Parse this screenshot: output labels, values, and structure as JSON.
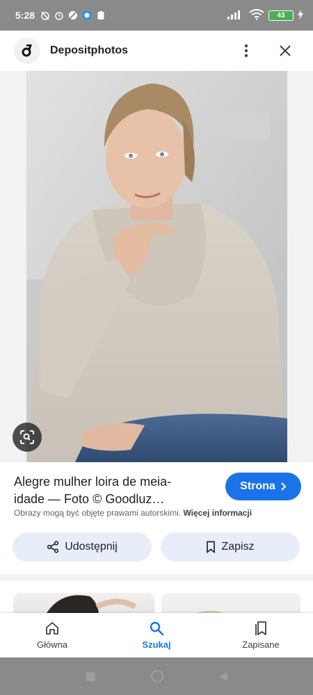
{
  "status_bar": {
    "time": "5:28",
    "battery": "43"
  },
  "header": {
    "site_name": "Depositphotos"
  },
  "result": {
    "title": "Alegre mulher loira de meia-idade — Foto © Goodluz…",
    "visit_label": "Strona",
    "copyright_notice": "Obrazy mogą być objęte prawami autorskimi.",
    "more_info_label": "Więcej informacji",
    "share_label": "Udostępnij",
    "save_label": "Zapisz"
  },
  "bottom_nav": {
    "items": [
      {
        "label": "Główna",
        "icon": "home-icon",
        "active": false
      },
      {
        "label": "Szukaj",
        "icon": "search-icon",
        "active": true
      },
      {
        "label": "Zapisane",
        "icon": "bookmarks-icon",
        "active": false
      }
    ]
  },
  "colors": {
    "accent": "#1a73e8",
    "chip_bg": "#e8eef9",
    "status_bar": "#8a8a8a"
  }
}
